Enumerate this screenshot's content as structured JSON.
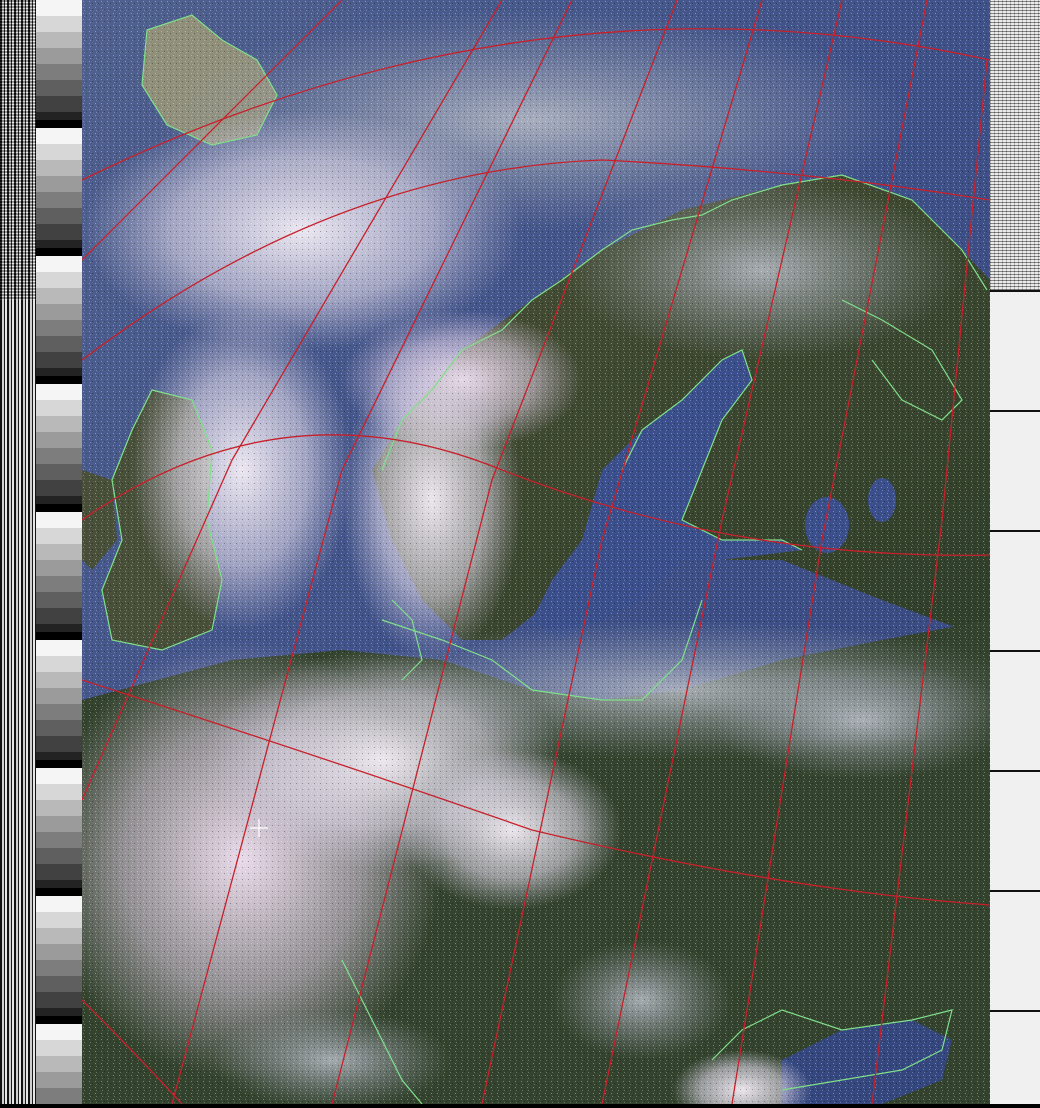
{
  "image": {
    "description_label": "",
    "palette": {
      "ocean": "#3b4e86",
      "land_dark": "#2f3d2c",
      "land_forest": "#3a4a2e",
      "cloud": "#e8e4ef",
      "cloud_pink": "#e9d9ec",
      "coastline": "#7fe08a",
      "graticule": "#c8202a",
      "telemetry_bg": "#f0f0f0",
      "sync_dark": "#111111"
    }
  }
}
